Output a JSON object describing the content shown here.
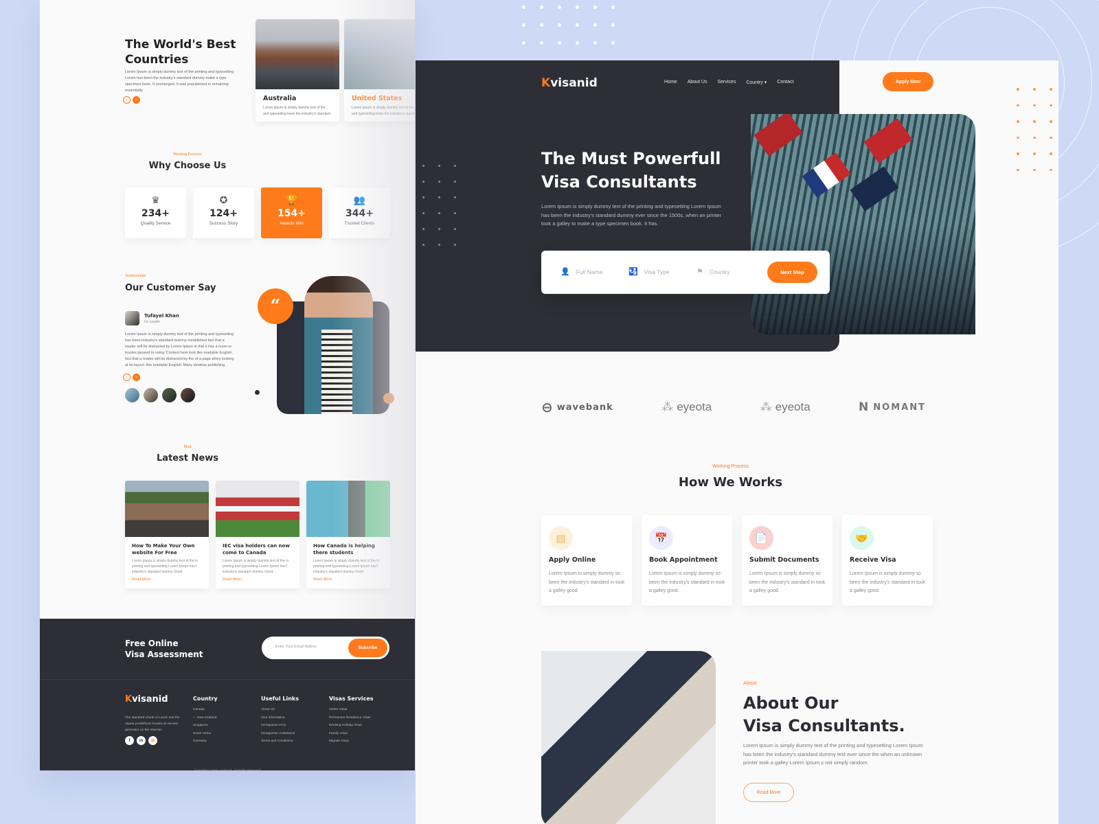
{
  "brand": {
    "logo_first": "K",
    "logo_rest": "visanid",
    "accent": "#ff7a1a",
    "dark": "#2d2e36"
  },
  "left_page": {
    "countries": {
      "title_line1": "The World's Best",
      "title_line2": "Countries",
      "description": "Lorem Ipsum is simply dummy text of the printing and typesetting Lorem has been the industry's standard dummy make a type specimen book. It unchanged. It was popularised in remaining essentially.",
      "prev_icon": "‹",
      "next_icon": "›",
      "cards": [
        {
          "name": "Australia",
          "desc": "Lorem Ipsum is simply dummy text of the and typesetting been the industry's standard."
        },
        {
          "name": "United States",
          "desc": "Lorem Ipsum is simply dummy text of the and typesetting been the industry's standard."
        },
        {
          "name": "",
          "desc": ""
        }
      ]
    },
    "why": {
      "kicker": "Working Process",
      "title": "Why Choose Us",
      "stats": [
        {
          "icon": "♛",
          "number": "234+",
          "label": "Quality Service"
        },
        {
          "icon": "✪",
          "number": "124+",
          "label": "Success Story"
        },
        {
          "icon": "🏆",
          "number": "154+",
          "label": "Awards Win"
        },
        {
          "icon": "👥",
          "number": "344+",
          "label": "Trusted Clients"
        }
      ]
    },
    "testimonials": {
      "kicker": "Testimonials",
      "title": "Our Customer Say",
      "author_name": "Tufayel Khan",
      "author_role": "Ux Leader",
      "quote": "Lorem Ipsum is simply dummy text of the printing and typesetting has been industry's standard dummy established fact that a reader will be distracted by Lorem Ipsum is that it has a more-or lessles ppused to using 'Content here look like readable English. fact that a reader will be distracted by the of a page when looking at its layout. like readable English. Many desktop publishing.",
      "quote_mark": "“",
      "prev_icon": "‹",
      "next_icon": "›"
    },
    "news": {
      "kicker": "Blog",
      "title": "Latest News",
      "items": [
        {
          "title": "How To Make Your Own website For Free",
          "desc": "Lorem Ipsum is simply dummy text of the in printing and typesetting Lorem Ipsum has't industry's standard dummy Good.",
          "link": "Read More.."
        },
        {
          "title": "IEC visa holders can now come to Canada",
          "desc": "Lorem Ipsum is simply dummy text of the in printing and typesetting Lorem Ipsum has't industry's standard dummy Good.",
          "link": "Read More.."
        },
        {
          "title": "How Canada is helping there students",
          "desc": "Lorem Ipsum is simply dummy text of the in printing and typesetting Lorem Ipsum has't industry's standard dummy Good.",
          "link": "Read More.."
        }
      ]
    },
    "footer": {
      "cta_line1": "Free Online",
      "cta_line2": "Visa Assessment",
      "email_placeholder": "Enter Your Email Addres",
      "subscribe_label": "Subcribe",
      "about": "The standard chunk of Lorem text the repeat predefined chunks as necess generator on the Internet.",
      "social": [
        "f",
        "in",
        "◎"
      ],
      "columns": [
        {
          "title": "Country",
          "links": [
            "Canada",
            "— New Zealand",
            "Singapore",
            "South Africa",
            "Germany"
          ]
        },
        {
          "title": "Useful Links",
          "links": [
            "About Us",
            "Visa Information",
            "Immigration FAQ",
            "Immigration Assistance",
            "Terms and Conditions"
          ]
        },
        {
          "title": "Visas Services",
          "links": [
            "Visitor Visas",
            "Permanent Residence Visas",
            "Working Holiday Visas",
            "Family Visas",
            "Migrate Visas"
          ]
        }
      ],
      "copyright": "Copyright © 2020, Kvisanid. All Rights Reserved"
    }
  },
  "right_page": {
    "nav": {
      "items": [
        "Home",
        "About Us",
        "Services",
        "Country ▾",
        "Contact"
      ],
      "apply_label": "Apply Now"
    },
    "hero": {
      "title_line1": "The Must Powerfull",
      "title_line2": "Visa Consultants",
      "description": "Lorem Ipsum is simply dummy text of the printing and typesetting Lorem Ipsum has been the industry's standard dummy ever since the 1500s, when an printer took a galley to make a type specimen book. It has."
    },
    "search_form": {
      "fields": [
        {
          "icon": "👤",
          "placeholder": "Full Name"
        },
        {
          "icon": "🛂",
          "placeholder": "Visa Type"
        },
        {
          "icon": "⚑",
          "placeholder": "Country"
        }
      ],
      "submit_label": "Next Step"
    },
    "brands": [
      {
        "name": "wavebank",
        "icon": "⊖"
      },
      {
        "name": "eyeota",
        "icon": "⁂"
      },
      {
        "name": "eyeota",
        "icon": "⁂"
      },
      {
        "name": "NOMANT",
        "icon": "N"
      }
    ],
    "how": {
      "kicker": "Working Process",
      "title": "How We Works",
      "steps": [
        {
          "icon": "▤",
          "title": "Apply Online",
          "desc": "Lorem Ipsum is simply dummy so been the industry's standard in took a galley good.",
          "icon_bg": "#fdf1dd",
          "icon_color": "#f3b95a"
        },
        {
          "icon": "📅",
          "title": "Book Appointment",
          "desc": "Lorem Ipsum is simply dummy so been the industry's standard in took a galley good.",
          "icon_bg": "#e8edff",
          "icon_color": "#7e93e6"
        },
        {
          "icon": "📄",
          "title": "Submit Documents",
          "desc": "Lorem Ipsum is simply dummy so been the industry's standard in took a galley good.",
          "icon_bg": "#fbd0d0",
          "icon_color": "#ec7a7a"
        },
        {
          "icon": "🤝",
          "title": "Receive Visa",
          "desc": "Lorem Ipsum is simply dummy so been the industry's standard in took a galley good.",
          "icon_bg": "#dcf7ee",
          "icon_color": "#3fc79a"
        }
      ]
    },
    "about": {
      "kicker": "About",
      "title_line1": "About Our",
      "title_line2": "Visa Consultants.",
      "description": "Lorem Ipsum is simply dummy text of the printing and typesetting Lorem Ipsum has been the industry's standard dummy text ever since the when an unknown printer took a galley Lorem Ipsum s not simply random.",
      "button_label": "Read More"
    }
  }
}
